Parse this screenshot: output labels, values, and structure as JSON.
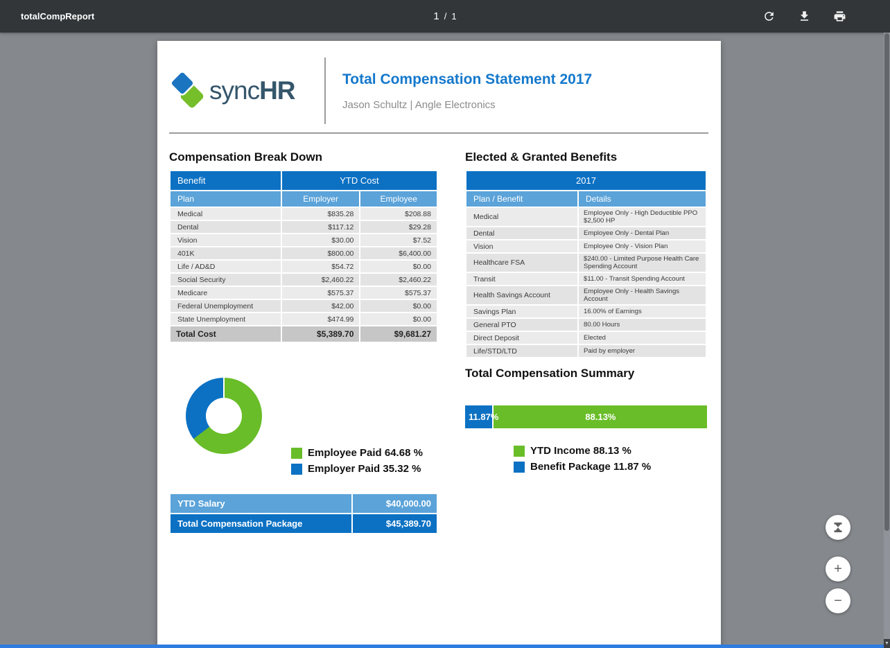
{
  "colors": {
    "toolbar_bg": "#323639",
    "viewer_bg": "#85898d",
    "header_blue": "#0c71c3",
    "light_blue": "#5ba3d9",
    "green": "#69bd28",
    "title_blue": "#1478cc",
    "total_row_gray": "#c6c6c6",
    "bottom_strip_blue": "#2e7ce0"
  },
  "toolbar": {
    "title": "totalCompReport",
    "page": {
      "current": "1",
      "separator": "/",
      "total": "1"
    }
  },
  "header": {
    "logo_sync": "sync",
    "logo_hr": "HR",
    "title": "Total Compensation Statement 2017",
    "subtitle": "Jason Schultz | Angle Electronics"
  },
  "compensation": {
    "heading": "Compensation Break Down",
    "col_benefit": "Benefit",
    "col_ytd": "YTD Cost",
    "col_plan": "Plan",
    "col_employer": "Employer",
    "col_employee": "Employee",
    "rows": [
      {
        "plan": "Medical",
        "employer": "$835.28",
        "employee": "$208.88"
      },
      {
        "plan": "Dental",
        "employer": "$117.12",
        "employee": "$29.28"
      },
      {
        "plan": "Vision",
        "employer": "$30.00",
        "employee": "$7.52"
      },
      {
        "plan": "401K",
        "employer": "$800.00",
        "employee": "$6,400.00"
      },
      {
        "plan": "Life / AD&D",
        "employer": "$54.72",
        "employee": "$0.00"
      },
      {
        "plan": "Social Security",
        "employer": "$2,460.22",
        "employee": "$2,460.22"
      },
      {
        "plan": "Medicare",
        "employer": "$575.37",
        "employee": "$575.37"
      },
      {
        "plan": "Federal Unemployment",
        "employer": "$42.00",
        "employee": "$0.00"
      },
      {
        "plan": "State Unemployment",
        "employer": "$474.99",
        "employee": "$0.00"
      }
    ],
    "total": {
      "label": "Total Cost",
      "employer": "$5,389.70",
      "employee": "$9,681.27"
    }
  },
  "benefits": {
    "heading": "Elected & Granted Benefits",
    "col_year": "2017",
    "col_plan": "Plan / Benefit",
    "col_details": "Details",
    "rows": [
      {
        "plan": "Medical",
        "details": "Employee Only - High Deductible PPO $2,500 HP"
      },
      {
        "plan": "Dental",
        "details": "Employee Only - Dental Plan"
      },
      {
        "plan": "Vision",
        "details": "Employee Only - Vision Plan"
      },
      {
        "plan": "Healthcare FSA",
        "details": "$240.00 - Limited Purpose Health Care Spending Account"
      },
      {
        "plan": "Transit",
        "details": "$11.00 - Transit Spending Account"
      },
      {
        "plan": "Health Savings Account",
        "details": "Employee Only - Health Savings Account"
      },
      {
        "plan": "Savings Plan",
        "details": "16.00% of Earnings"
      },
      {
        "plan": "General PTO",
        "details": "80.00 Hours"
      },
      {
        "plan": "Direct Deposit",
        "details": "Elected"
      },
      {
        "plan": "Life/STD/LTD",
        "details": "Paid by employer"
      }
    ]
  },
  "salary_table": {
    "rows": [
      {
        "label": "YTD Salary",
        "value": "$40,000.00"
      },
      {
        "label": "Total Compensation Package",
        "value": "$45,389.70"
      }
    ]
  },
  "summary": {
    "heading": "Total Compensation Summary"
  },
  "chart_data": [
    {
      "type": "pie",
      "subtype": "donut",
      "title": "",
      "labels": [
        "Employee Paid",
        "Employer Paid"
      ],
      "values": [
        64.68,
        35.32
      ],
      "colors": [
        "#69bd28",
        "#0c71c3"
      ],
      "legend": [
        {
          "label": "Employee Paid 64.68 %"
        },
        {
          "label": "Employer Paid 35.32 %"
        }
      ],
      "legend_position": "right"
    },
    {
      "type": "bar",
      "subtype": "stacked-horizontal",
      "title": "Total Compensation Summary",
      "labels": [
        "Benefit Package",
        "YTD Income"
      ],
      "values": [
        11.87,
        88.13
      ],
      "colors": [
        "#0c71c3",
        "#69bd28"
      ],
      "bar_labels": [
        "11.87%",
        "88.13%"
      ],
      "legend": [
        {
          "label": "YTD Income 88.13 %"
        },
        {
          "label": "Benefit Package 11.87 %"
        }
      ],
      "xlim": [
        0,
        100
      ]
    }
  ]
}
